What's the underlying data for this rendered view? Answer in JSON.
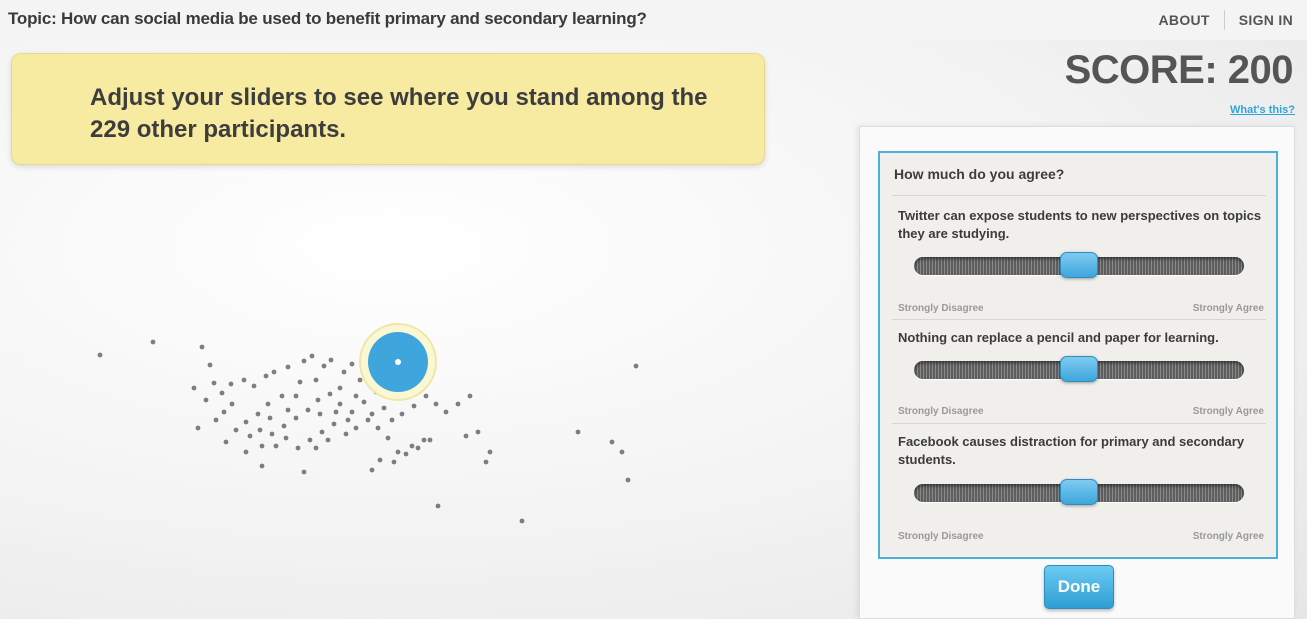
{
  "header": {
    "topic": "Topic: How can social media be used to benefit primary and secondary learning?",
    "nav": {
      "about": "ABOUT",
      "sign_in": "SIGN IN"
    }
  },
  "banner": {
    "text": "Adjust your sliders to see where you stand among the 229 other participants."
  },
  "score": {
    "label": "SCORE: 200",
    "whats_this": "What's this?"
  },
  "panel": {
    "title": "How much do you agree?",
    "questions": [
      {
        "text": "Twitter can expose students to new perspectives on topics they are studying.",
        "value": 0.5,
        "min_label": "Strongly Disagree",
        "max_label": "Strongly Agree"
      },
      {
        "text": "Nothing can replace a pencil and paper for learning.",
        "value": 0.5,
        "min_label": "Strongly Disagree",
        "max_label": "Strongly Agree"
      },
      {
        "text": "Facebook causes distraction for primary and secondary students.",
        "value": 0.5,
        "min_label": "Strongly Disagree",
        "max_label": "Strongly Agree"
      }
    ],
    "done_label": "Done"
  },
  "colors": {
    "accent": "#4bb0dc",
    "banner": "#f7eba2",
    "dot": "#555555",
    "you_marker": "#3ea6dc"
  }
}
